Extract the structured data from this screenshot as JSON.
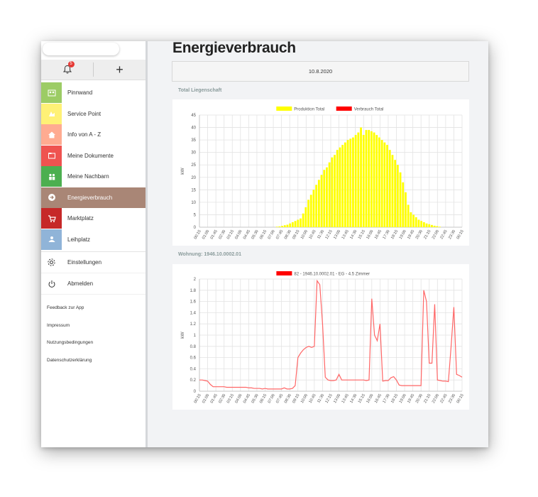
{
  "topbar": {
    "notification_count": "5"
  },
  "menu": [
    {
      "label": "Pinnwand",
      "color": "#9ccc65",
      "icon": "people-board-icon"
    },
    {
      "label": "Service Point",
      "color": "#fff176",
      "icon": "service-point-icon"
    },
    {
      "label": "Info von A - Z",
      "color": "#ffab91",
      "icon": "house-icon"
    },
    {
      "label": "Meine Dokumente",
      "color": "#ef5350",
      "icon": "folder-icon"
    },
    {
      "label": "Meine Nachbarn",
      "color": "#4caf50",
      "icon": "neighbors-icon"
    },
    {
      "label": "Energieverbrauch",
      "color": "#a98676",
      "icon": "energy-icon",
      "active": true
    },
    {
      "label": "Marktplatz",
      "color": "#c62828",
      "icon": "cart-icon"
    },
    {
      "label": "Leihplatz",
      "color": "#90b4d8",
      "icon": "lend-icon"
    }
  ],
  "settings": {
    "label": "Einstellungen"
  },
  "logout": {
    "label": "Abmelden"
  },
  "links": [
    "Feedback zur App",
    "Impressum",
    "Nutzungsbedingungen",
    "Datenschutzerklärung"
  ],
  "page": {
    "title": "Energieverbrauch",
    "date": "10.8.2020",
    "section1": "Total Liegenschaft",
    "section2": "Wohnung: 1946.10.0002.01"
  },
  "chart_data": [
    {
      "type": "bar",
      "title": "",
      "ylabel": "kW",
      "ylim": [
        0,
        45
      ],
      "yticks": [
        0,
        5,
        10,
        15,
        20,
        25,
        30,
        35,
        40,
        45
      ],
      "xticks": [
        "00:15",
        "01:00",
        "01:45",
        "02:30",
        "03:15",
        "04:00",
        "04:45",
        "05:30",
        "06:15",
        "07:00",
        "07:45",
        "08:30",
        "09:15",
        "10:00",
        "10:45",
        "11:30",
        "12:15",
        "13:00",
        "13:45",
        "14:30",
        "15:15",
        "16:00",
        "16:45",
        "17:30",
        "18:15",
        "19:00",
        "19:45",
        "20:30",
        "21:15",
        "22:00",
        "22:45",
        "23:30",
        "00:15"
      ],
      "grid": true,
      "legend": {
        "position": "top",
        "entries": [
          {
            "name": "Produktion Total",
            "color": "#ffff00"
          },
          {
            "name": "Verbrauch Total",
            "color": "#ff0000"
          }
        ]
      },
      "series": [
        {
          "name": "Produktion Total",
          "color": "#ffff00",
          "values": [
            0,
            0,
            0,
            0,
            0,
            0,
            0,
            0,
            0,
            0,
            0,
            0,
            0,
            0,
            0,
            0,
            0,
            0,
            0,
            0,
            0,
            0,
            0,
            0,
            0,
            0,
            0,
            0,
            0,
            0.2,
            0.3,
            0.5,
            0.8,
            1.0,
            1.5,
            2.0,
            2.5,
            3.0,
            3.5,
            5.5,
            8,
            11,
            13,
            15,
            17,
            19,
            21,
            23,
            24,
            26,
            28,
            29,
            31,
            32,
            33,
            34,
            35,
            35.5,
            36,
            37,
            38,
            40,
            37,
            39,
            39,
            38.5,
            38,
            37,
            36,
            35,
            34,
            33,
            31,
            29,
            27,
            25,
            22,
            18,
            14,
            9,
            6,
            5,
            4,
            3,
            2.5,
            2,
            1.5,
            1.2,
            0.9,
            0.6,
            0.4,
            0.2,
            0,
            0,
            0,
            0,
            0,
            0,
            0,
            0
          ]
        },
        {
          "name": "Verbrauch Total",
          "color": "#ff0000",
          "values": []
        }
      ]
    },
    {
      "type": "line",
      "title": "",
      "ylabel": "kW",
      "ylim": [
        0,
        2.0
      ],
      "yticks": [
        0,
        0.2,
        0.4,
        0.6,
        0.8,
        1.0,
        1.2,
        1.4,
        1.6,
        1.8,
        2.0
      ],
      "xticks": [
        "00:15",
        "01:00",
        "01:45",
        "02:30",
        "03:15",
        "04:00",
        "04:45",
        "05:30",
        "06:15",
        "07:00",
        "07:45",
        "08:30",
        "09:15",
        "10:00",
        "10:45",
        "11:30",
        "12:15",
        "13:00",
        "13:45",
        "14:30",
        "15:15",
        "16:00",
        "16:45",
        "17:30",
        "18:15",
        "19:00",
        "19:45",
        "20:30",
        "21:15",
        "22:00",
        "22:45",
        "23:30",
        "00:15"
      ],
      "grid": true,
      "legend": {
        "position": "top",
        "entries": [
          {
            "name": "82 - 1946.10.0002.01 - EG - 4.5 Zimmer",
            "color": "#ff0000"
          }
        ]
      },
      "series": [
        {
          "name": "82 - 1946.10.0002.01 - EG - 4.5 Zimmer",
          "color": "#ff6666",
          "values": [
            0.2,
            0.2,
            0.19,
            0.18,
            0.12,
            0.08,
            0.08,
            0.08,
            0.08,
            0.08,
            0.07,
            0.07,
            0.07,
            0.07,
            0.07,
            0.07,
            0.07,
            0.07,
            0.06,
            0.06,
            0.05,
            0.05,
            0.05,
            0.04,
            0.05,
            0.04,
            0.04,
            0.04,
            0.04,
            0.04,
            0.04,
            0.06,
            0.04,
            0.04,
            0.05,
            0.1,
            0.6,
            0.68,
            0.74,
            0.78,
            0.8,
            0.78,
            0.8,
            1.97,
            1.9,
            1.2,
            0.25,
            0.2,
            0.19,
            0.19,
            0.2,
            0.3,
            0.2,
            0.2,
            0.2,
            0.2,
            0.2,
            0.2,
            0.2,
            0.2,
            0.2,
            0.19,
            0.2,
            1.65,
            1.0,
            0.9,
            1.2,
            0.18,
            0.19,
            0.19,
            0.24,
            0.26,
            0.2,
            0.11,
            0.1,
            0.1,
            0.1,
            0.1,
            0.1,
            0.1,
            0.1,
            0.1,
            1.8,
            1.6,
            0.5,
            0.5,
            1.55,
            0.2,
            0.19,
            0.18,
            0.18,
            0.17,
            0.8,
            1.5,
            0.3,
            0.28,
            0.25
          ]
        }
      ]
    }
  ]
}
